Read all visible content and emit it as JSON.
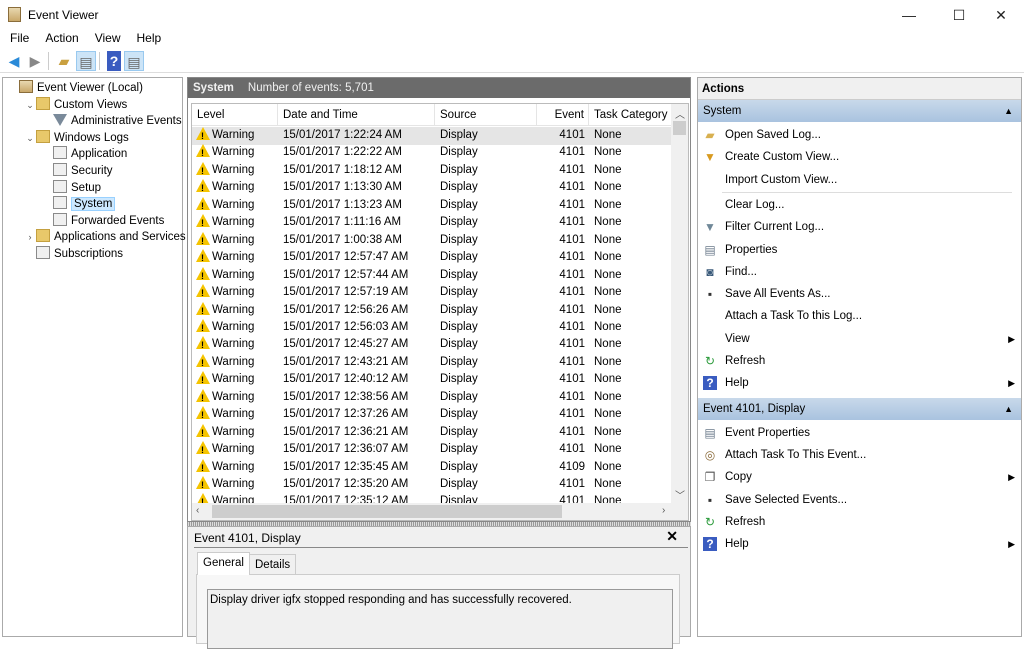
{
  "window": {
    "title": "Event Viewer",
    "minimize": "—",
    "maximize": "☐",
    "close": "✕"
  },
  "menu": [
    "File",
    "Action",
    "View",
    "Help"
  ],
  "toolbar": {
    "back": "back-icon",
    "forward": "forward-icon",
    "up": "folder-up-icon",
    "show_tree": "show-hide-console-tree-icon",
    "help": "help-icon",
    "show_actions": "show-hide-action-pane-icon"
  },
  "tree": [
    {
      "label": "Event Viewer (Local)",
      "level": 0,
      "icon": "event-viewer",
      "chev": ""
    },
    {
      "label": "Custom Views",
      "level": 1,
      "icon": "folder",
      "chev": "⌄"
    },
    {
      "label": "Administrative Events",
      "level": 2,
      "icon": "funnel",
      "chev": ""
    },
    {
      "label": "Windows Logs",
      "level": 1,
      "icon": "folder",
      "chev": "⌄"
    },
    {
      "label": "Application",
      "level": 2,
      "icon": "log",
      "chev": ""
    },
    {
      "label": "Security",
      "level": 2,
      "icon": "log",
      "chev": ""
    },
    {
      "label": "Setup",
      "level": 2,
      "icon": "log",
      "chev": ""
    },
    {
      "label": "System",
      "level": 2,
      "icon": "log",
      "chev": "",
      "selected": true
    },
    {
      "label": "Forwarded Events",
      "level": 2,
      "icon": "log",
      "chev": ""
    },
    {
      "label": "Applications and Services Lo",
      "level": 1,
      "icon": "folder",
      "chev": "›"
    },
    {
      "label": "Subscriptions",
      "level": 1,
      "icon": "log",
      "chev": ""
    }
  ],
  "log": {
    "name": "System",
    "count_label": "Number of events: 5,701"
  },
  "columns": [
    "Level",
    "Date and Time",
    "Source",
    "Event ID",
    "Task Category"
  ],
  "rows": [
    [
      "Warning",
      "15/01/2017 1:22:24 AM",
      "Display",
      "4101",
      "None"
    ],
    [
      "Warning",
      "15/01/2017 1:22:22 AM",
      "Display",
      "4101",
      "None"
    ],
    [
      "Warning",
      "15/01/2017 1:18:12 AM",
      "Display",
      "4101",
      "None"
    ],
    [
      "Warning",
      "15/01/2017 1:13:30 AM",
      "Display",
      "4101",
      "None"
    ],
    [
      "Warning",
      "15/01/2017 1:13:23 AM",
      "Display",
      "4101",
      "None"
    ],
    [
      "Warning",
      "15/01/2017 1:11:16 AM",
      "Display",
      "4101",
      "None"
    ],
    [
      "Warning",
      "15/01/2017 1:00:38 AM",
      "Display",
      "4101",
      "None"
    ],
    [
      "Warning",
      "15/01/2017 12:57:47 AM",
      "Display",
      "4101",
      "None"
    ],
    [
      "Warning",
      "15/01/2017 12:57:44 AM",
      "Display",
      "4101",
      "None"
    ],
    [
      "Warning",
      "15/01/2017 12:57:19 AM",
      "Display",
      "4101",
      "None"
    ],
    [
      "Warning",
      "15/01/2017 12:56:26 AM",
      "Display",
      "4101",
      "None"
    ],
    [
      "Warning",
      "15/01/2017 12:56:03 AM",
      "Display",
      "4101",
      "None"
    ],
    [
      "Warning",
      "15/01/2017 12:45:27 AM",
      "Display",
      "4101",
      "None"
    ],
    [
      "Warning",
      "15/01/2017 12:43:21 AM",
      "Display",
      "4101",
      "None"
    ],
    [
      "Warning",
      "15/01/2017 12:40:12 AM",
      "Display",
      "4101",
      "None"
    ],
    [
      "Warning",
      "15/01/2017 12:38:56 AM",
      "Display",
      "4101",
      "None"
    ],
    [
      "Warning",
      "15/01/2017 12:37:26 AM",
      "Display",
      "4101",
      "None"
    ],
    [
      "Warning",
      "15/01/2017 12:36:21 AM",
      "Display",
      "4101",
      "None"
    ],
    [
      "Warning",
      "15/01/2017 12:36:07 AM",
      "Display",
      "4101",
      "None"
    ],
    [
      "Warning",
      "15/01/2017 12:35:45 AM",
      "Display",
      "4109",
      "None"
    ],
    [
      "Warning",
      "15/01/2017 12:35:20 AM",
      "Display",
      "4101",
      "None"
    ],
    [
      "Warning",
      "15/01/2017 12:35:12 AM",
      "Display",
      "4101",
      "None"
    ]
  ],
  "detail": {
    "title": "Event 4101, Display",
    "close": "✕",
    "tabs": [
      "General",
      "Details"
    ],
    "description": "Display driver igfx stopped responding and has successfully recovered."
  },
  "actions": {
    "header": "Actions",
    "sections": [
      {
        "title": "System",
        "items": [
          {
            "label": "Open Saved Log...",
            "icon": "open-folder"
          },
          {
            "label": "Create Custom View...",
            "icon": "funnel-star"
          },
          {
            "label": "Import Custom View...",
            "icon": ""
          },
          {
            "separator": true
          },
          {
            "label": "Clear Log...",
            "icon": ""
          },
          {
            "label": "Filter Current Log...",
            "icon": "funnel"
          },
          {
            "label": "Properties",
            "icon": "properties"
          },
          {
            "label": "Find...",
            "icon": "binoculars"
          },
          {
            "label": "Save All Events As...",
            "icon": "save"
          },
          {
            "label": "Attach a Task To this Log...",
            "icon": ""
          },
          {
            "label": "View",
            "icon": "",
            "submenu": true
          },
          {
            "label": "Refresh",
            "icon": "refresh"
          },
          {
            "label": "Help",
            "icon": "help",
            "submenu": true
          }
        ]
      },
      {
        "title": "Event 4101, Display",
        "items": [
          {
            "label": "Event Properties",
            "icon": "properties"
          },
          {
            "label": "Attach Task To This Event...",
            "icon": "task"
          },
          {
            "label": "Copy",
            "icon": "copy",
            "submenu": true
          },
          {
            "label": "Save Selected Events...",
            "icon": "save"
          },
          {
            "label": "Refresh",
            "icon": "refresh"
          },
          {
            "label": "Help",
            "icon": "help",
            "submenu": true
          }
        ]
      }
    ]
  }
}
